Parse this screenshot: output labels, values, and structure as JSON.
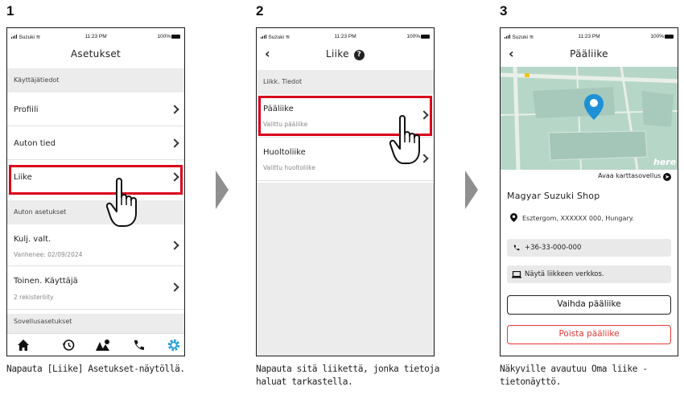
{
  "steps": [
    {
      "num": "1",
      "caption": "Napauta [Liike] Asetukset-näytöllä."
    },
    {
      "num": "2",
      "caption": "Napauta sitä liikettä, jonka tietoja haluat tarkastella."
    },
    {
      "num": "3",
      "caption": "Näkyville avautuu Oma liike -tietonäyttö."
    }
  ],
  "status": {
    "carrier": "Suzuki",
    "time": "11:23 PM",
    "battery": "100%"
  },
  "screen1": {
    "title": "Asetukset",
    "section_user": "Käyttäjätiedot",
    "profile": "Profiili",
    "car_info": "Auton tied",
    "dealer": "Liike",
    "section_car": "Auton asetukset",
    "driver": "Kulj. valt.",
    "driver_sub": "Vanhenee: 02/09/2024",
    "second_user": "Toinen. Käyttäjä",
    "second_user_sub": "2 rekisteröity",
    "section_app": "Sovellusasetukset"
  },
  "screen2": {
    "title": "Liike",
    "section": "Liikk. Tiedot",
    "main_dealer": "Pääliike",
    "main_dealer_sub": "Valittu pääliike",
    "service_dealer": "Huoltoliike",
    "service_dealer_sub": "Valittu huoltoliike"
  },
  "screen3": {
    "title": "Pääliike",
    "open_map": "Avaa karttasovellus",
    "shop_name": "Magyar Suzuki Shop",
    "address": "Esztergom, XXXXXX 000, Hungary.",
    "phone": "+36-33-000-000",
    "website": "Näytä liikkeen verkkos.",
    "change_btn": "Vaihda pääliike",
    "remove_btn": "Poista pääliike",
    "map_label": "here"
  },
  "colors": {
    "highlight": "#d9001b",
    "tab_active": "#2a9fd8",
    "map_bg": "#b3d3c6",
    "pin": "#1e90d6",
    "danger": "#e53935"
  }
}
